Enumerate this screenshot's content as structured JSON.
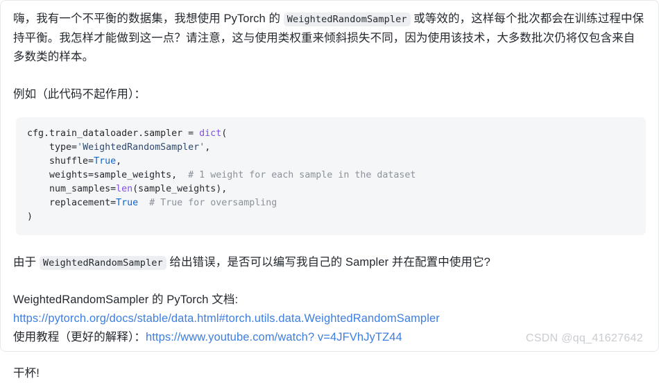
{
  "colors": {
    "background": "#ffffff",
    "card_border": "#e6e8eb",
    "text": "#24292f",
    "link": "#3d7ee0",
    "code_block_bg": "#f5f6f8",
    "inline_code_bg": "#eceef1",
    "comment": "#8a9199",
    "keyword": "#0a66d0",
    "function": "#8250df",
    "watermark": "#c9ccd1"
  },
  "post": {
    "intro": {
      "part1": "嗨，我有一个不平衡的数据集，我想使用 PyTorch 的 ",
      "inline_code": "WeightedRandomSampler",
      "part2": " 或等效的，这样每个批次都会在训练过程中保持平衡。我怎样才能做到这一点？请注意，这与使用类权重来倾斜损失不同，因为使用该技术，大多数批次仍将仅包含来自多数类的样本。"
    },
    "example_label": "例如（此代码不起作用）：",
    "code": {
      "language": "python",
      "lines": [
        {
          "tokens": [
            {
              "t": "cfg.train_dataloader.sampler = ",
              "c": "plain"
            },
            {
              "t": "dict",
              "c": "fn"
            },
            {
              "t": "(",
              "c": "plain"
            }
          ]
        },
        {
          "tokens": [
            {
              "t": "    type=",
              "c": "plain"
            },
            {
              "t": "'",
              "c": "quote"
            },
            {
              "t": "WeightedRandomSampler",
              "c": "str"
            },
            {
              "t": "'",
              "c": "quote"
            },
            {
              "t": ",",
              "c": "plain"
            }
          ]
        },
        {
          "tokens": [
            {
              "t": "    shuffle=",
              "c": "plain"
            },
            {
              "t": "True",
              "c": "kw"
            },
            {
              "t": ",",
              "c": "plain"
            }
          ]
        },
        {
          "tokens": [
            {
              "t": "    weights=sample_weights,  ",
              "c": "plain"
            },
            {
              "t": "# 1 weight for each sample in the dataset",
              "c": "cmt"
            }
          ]
        },
        {
          "tokens": [
            {
              "t": "    num_samples=",
              "c": "plain"
            },
            {
              "t": "len",
              "c": "fn"
            },
            {
              "t": "(sample_weights),",
              "c": "plain"
            }
          ]
        },
        {
          "tokens": [
            {
              "t": "    replacement=",
              "c": "plain"
            },
            {
              "t": "True",
              "c": "kw"
            },
            {
              "t": "  ",
              "c": "plain"
            },
            {
              "t": "# True for oversampling",
              "c": "cmt"
            }
          ]
        },
        {
          "tokens": [
            {
              "t": ")",
              "c": "plain"
            }
          ]
        }
      ]
    },
    "question": {
      "part1": "由于 ",
      "inline_code": "WeightedRandomSampler",
      "part2": " 给出错误，是否可以编写我自己的 Sampler 并在配置中使用它?"
    },
    "docs": {
      "heading": "WeightedRandomSampler 的 PyTorch 文档:",
      "doc_link": "https://pytorch.org/docs/stable/data.html#torch.utils.data.WeightedRandomSampler",
      "tutorial_label": "使用教程（更好的解释）：",
      "tutorial_link": "https://www.youtube.com/watch? v=4JFVhJyTZ44"
    },
    "cheers": "干杯!"
  },
  "watermark": "CSDN @qq_41627642"
}
